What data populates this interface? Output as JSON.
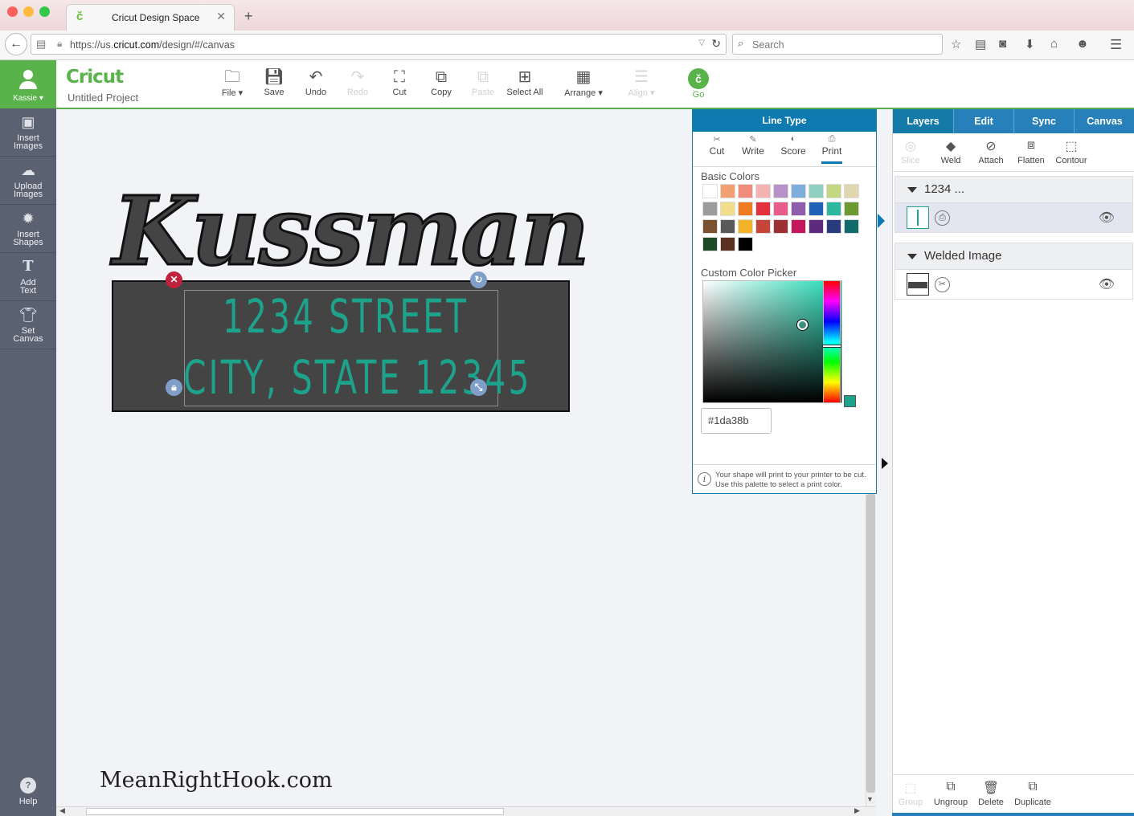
{
  "browser": {
    "tab_title": "Cricut Design Space",
    "tab_favicon": "č",
    "url_prefix": "https://us.",
    "url_host": "cricut.com",
    "url_path": "/design/#/canvas",
    "search_placeholder": "Search"
  },
  "leftnav": {
    "user": "Kassie",
    "items": [
      {
        "label1": "Insert",
        "label2": "Images",
        "icon": "image-icon"
      },
      {
        "label1": "Upload",
        "label2": "Images",
        "icon": "cloud-upload-icon"
      },
      {
        "label1": "Insert",
        "label2": "Shapes",
        "icon": "shapes-icon"
      },
      {
        "label1": "Add",
        "label2": "Text",
        "icon": "text-icon"
      },
      {
        "label1": "Set",
        "label2": "Canvas",
        "icon": "shirt-icon"
      }
    ],
    "help": "Help"
  },
  "toolbar": {
    "logo": "Cricut",
    "project_name": "Untitled Project",
    "tools": [
      "File",
      "Save",
      "Undo",
      "Redo",
      "Cut",
      "Copy",
      "Paste",
      "Select All",
      "Arrange",
      "Align"
    ],
    "go": "Go"
  },
  "canvas": {
    "name_text": "Kussman",
    "address_line1": "1234 STREET",
    "address_line2": "CITY, STATE 12345",
    "watermark": "MeanRightHook.com"
  },
  "line_type": {
    "title": "Line Type",
    "tabs": [
      "Cut",
      "Write",
      "Score",
      "Print"
    ],
    "active_tab": "Print",
    "basic_colors_label": "Basic Colors",
    "basic_colors": [
      "#ffffff",
      "#f2a070",
      "#f08c7c",
      "#f4b3b3",
      "#b792c8",
      "#7faedc",
      "#8fd0c0",
      "#c3d681",
      "#e0d7b0",
      "#9b9b9b",
      "#f0de8c",
      "#f07a20",
      "#e2303c",
      "#e85c8c",
      "#8e5cab",
      "#1f62b8",
      "#2fb8a0",
      "#6b9a33",
      "#7a5230",
      "#595959",
      "#f2b32a",
      "#c5453a",
      "#9c2f2f",
      "#c4185c",
      "#5e2a7e",
      "#2b3c7e",
      "#126a6a",
      "#1e4a2a",
      "#5a3020",
      "#000000"
    ],
    "custom_label": "Custom Color Picker",
    "hex_value": "#1da38b",
    "info_text": "Your shape will print to your printer to be cut. Use this palette to select a print color."
  },
  "layers": {
    "tabs": [
      "Layers",
      "Edit",
      "Sync",
      "Canvas"
    ],
    "tools": [
      "Slice",
      "Weld",
      "Attach",
      "Flatten",
      "Contour"
    ],
    "group1": "1234 ...",
    "group2": "Welded Image",
    "bottom_tools": [
      "Group",
      "Ungroup",
      "Delete",
      "Duplicate"
    ]
  }
}
